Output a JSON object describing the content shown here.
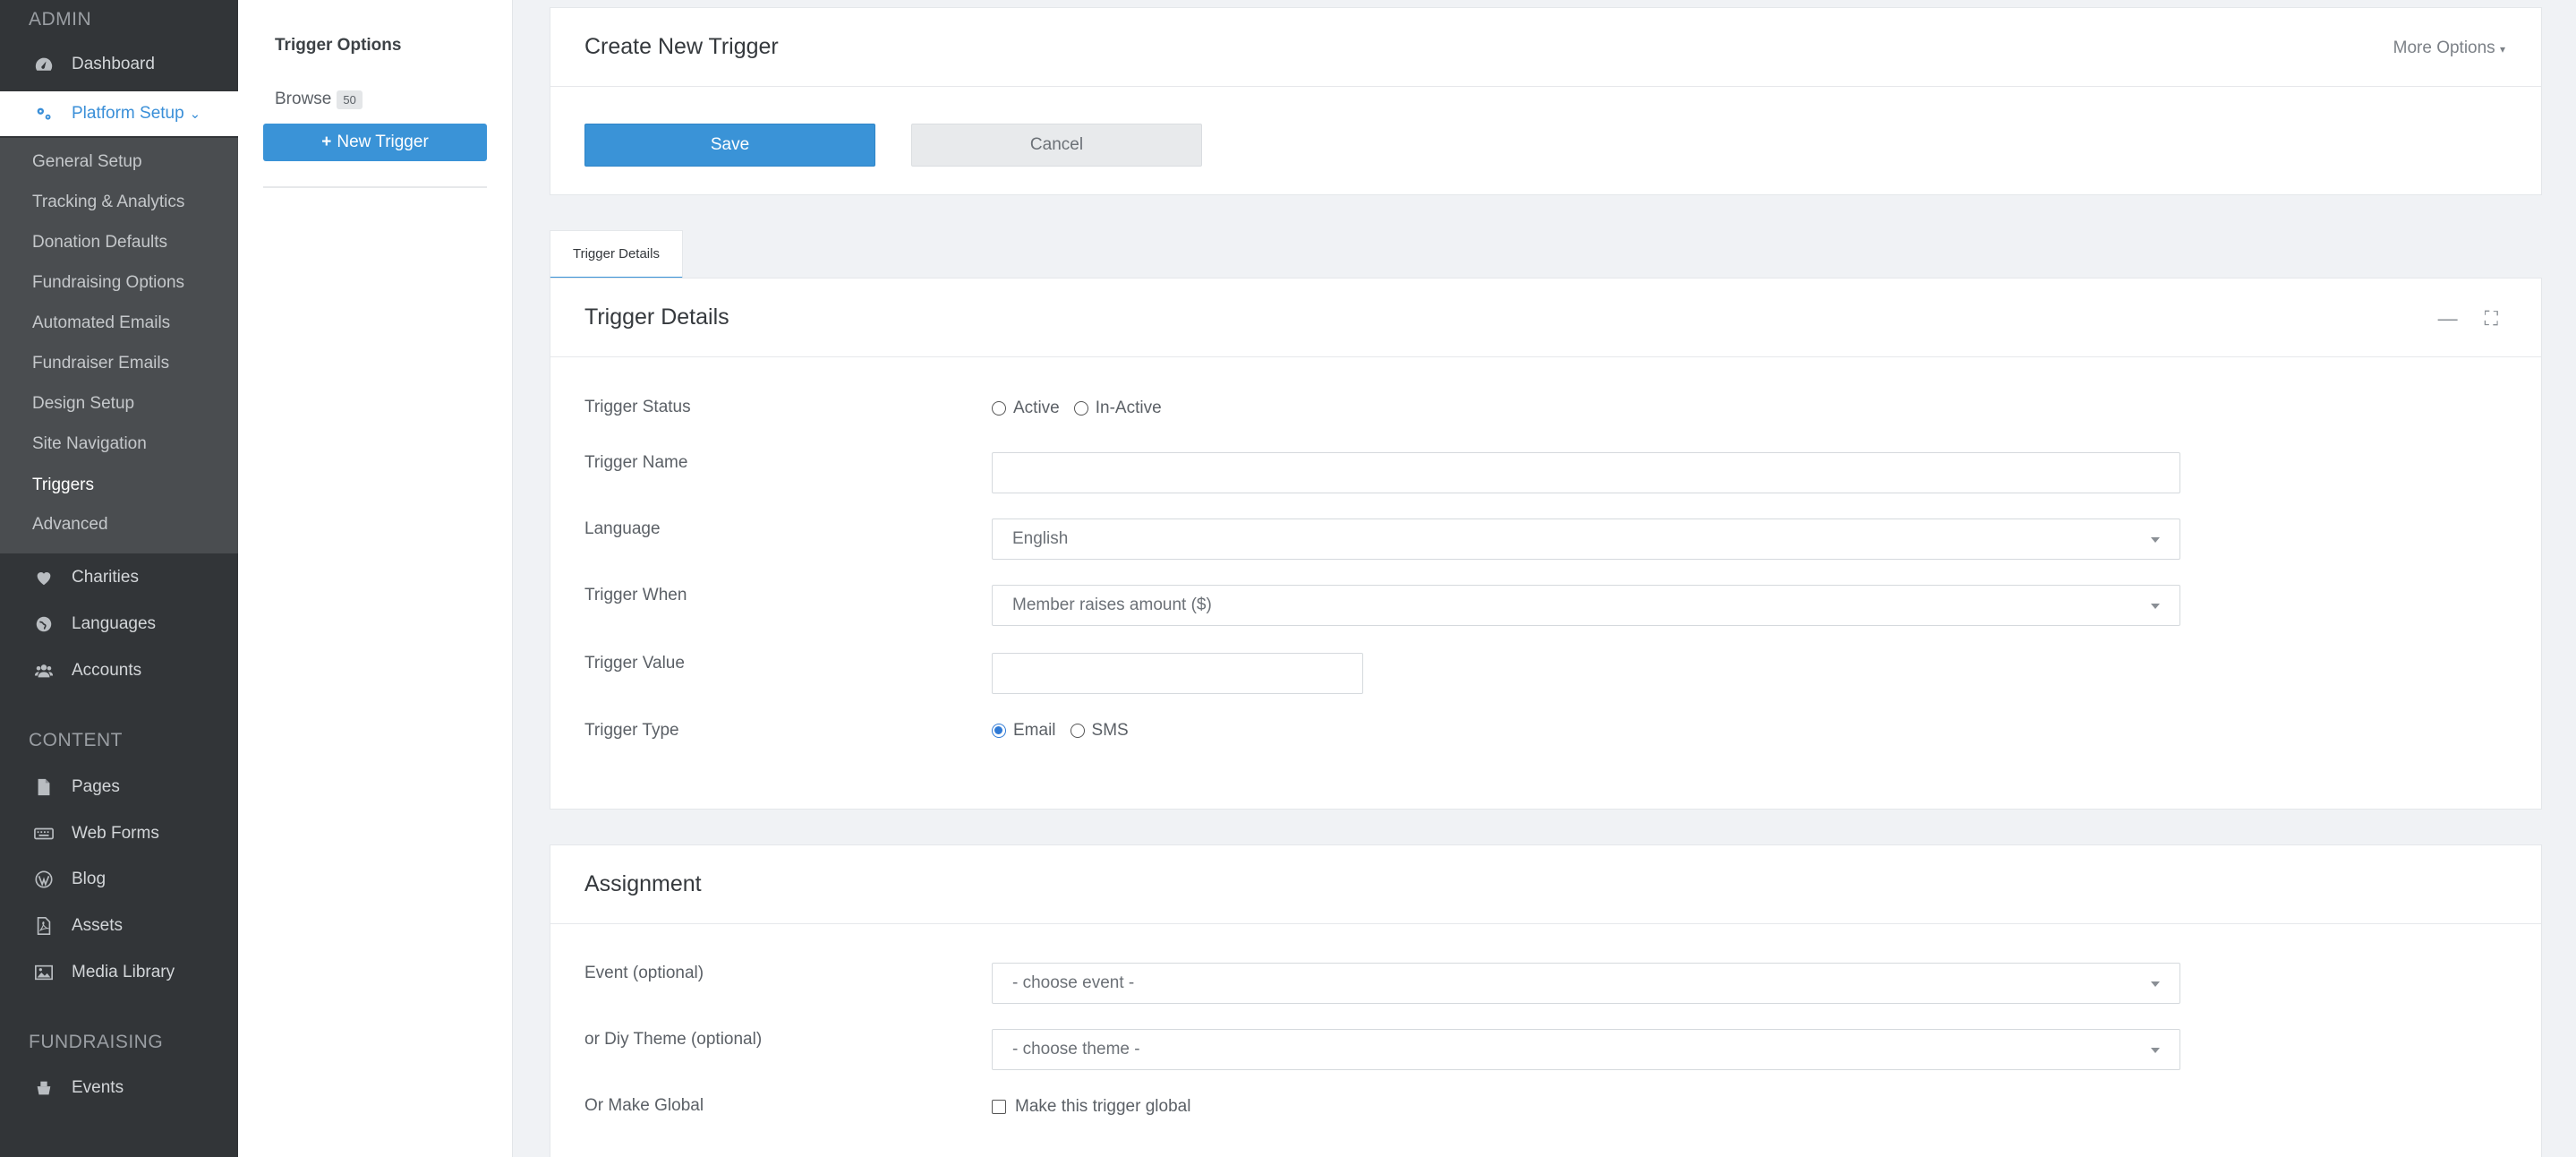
{
  "sidebar": {
    "admin_title": "ADMIN",
    "content_title": "CONTENT",
    "fundraising_title": "FUNDRAISING",
    "dashboard": "Dashboard",
    "platform_setup": "Platform Setup",
    "sub_items": [
      "General Setup",
      "Tracking & Analytics",
      "Donation Defaults",
      "Fundraising Options",
      "Automated Emails",
      "Fundraiser Emails",
      "Design Setup",
      "Site Navigation",
      "Triggers",
      "Advanced"
    ],
    "charities": "Charities",
    "languages": "Languages",
    "accounts": "Accounts",
    "pages": "Pages",
    "web_forms": "Web Forms",
    "blog": "Blog",
    "assets": "Assets",
    "media_library": "Media Library",
    "events": "Events"
  },
  "options": {
    "title": "Trigger Options",
    "browse": "Browse",
    "browse_count": "50",
    "new_trigger": "New Trigger"
  },
  "create": {
    "title": "Create New Trigger",
    "more_options": "More Options",
    "save": "Save",
    "cancel": "Cancel"
  },
  "tab_label": "Trigger Details",
  "details": {
    "title": "Trigger Details",
    "status_label": "Trigger Status",
    "status_active": "Active",
    "status_inactive": "In-Active",
    "name_label": "Trigger Name",
    "name_value": "",
    "language_label": "Language",
    "language_value": "English",
    "when_label": "Trigger When",
    "when_value": "Member raises amount ($)",
    "value_label": "Trigger Value",
    "value_value": "",
    "type_label": "Trigger Type",
    "type_email": "Email",
    "type_sms": "SMS"
  },
  "assignment": {
    "title": "Assignment",
    "event_label": "Event (optional)",
    "event_value": "- choose event -",
    "theme_label": "or Diy Theme (optional)",
    "theme_value": "- choose theme -",
    "global_label": "Or Make Global",
    "global_checkbox": "Make this trigger global"
  },
  "colors": {
    "sidebar_bg": "#323538",
    "submenu_bg": "#4a4d50",
    "accent": "#3a93d7"
  }
}
